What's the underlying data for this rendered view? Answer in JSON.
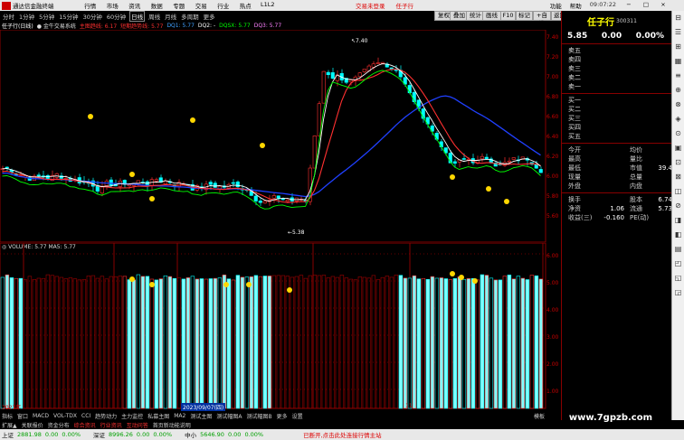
{
  "titlebar": {
    "app": "通达信金融终端",
    "menu": [
      "行情",
      "市场",
      "资讯",
      "数据",
      "专题",
      "交易",
      "行业",
      "热点",
      "L1L2"
    ],
    "promo": "交易未登录",
    "promo2": "任子行",
    "right_items": [
      "功能",
      "帮助"
    ],
    "clock": "09:07:22"
  },
  "periodbar": {
    "items": [
      "分时",
      "1分钟",
      "5分钟",
      "15分钟",
      "30分钟",
      "60分钟",
      "日线",
      "周线",
      "月线",
      "多周期",
      "更多"
    ],
    "active": "日线"
  },
  "toolbar_buttons": [
    "复权",
    "叠加",
    "统计",
    "画线",
    "F10",
    "标记",
    "+自选",
    "返回"
  ],
  "indicator_header": {
    "name": "任子行(日线)",
    "system": "● 金牛交易系统",
    "items": [
      {
        "text": "主图趋线: 6.17",
        "color": "#ff3030"
      },
      {
        "text": "短期趋势线: 5.77",
        "color": "#ff3030"
      },
      {
        "text": "DQ1: 5.77",
        "color": "#40a0ff"
      },
      {
        "text": "DQ2: -",
        "color": "#ffffff"
      },
      {
        "text": "DQSX: 5.77",
        "color": "#00ff00"
      },
      {
        "text": "DQ3: 5.77",
        "color": "#ff80ff"
      }
    ]
  },
  "volume_header": "◎ VOLUME: 5.77  MA5: 5.77",
  "chart_annotations": {
    "high": "7.40",
    "low": "5.38"
  },
  "y_axis_main": [
    "7.40",
    "7.20",
    "7.00",
    "6.80",
    "6.60",
    "6.40",
    "6.20",
    "6.00",
    "5.80",
    "5.60"
  ],
  "y_axis_vol": [
    "6.00",
    "5.00",
    "4.00",
    "3.00",
    "2.00",
    "1.00"
  ],
  "date_labels": [
    "2023年",
    "2023/09/07(四)",
    "11"
  ],
  "stock": {
    "name": "任子行",
    "code": "300311",
    "price": "5.85",
    "change": "0.00",
    "pct": "0.00%"
  },
  "orderbook": {
    "sell": [
      "卖五",
      "卖四",
      "卖三",
      "卖二",
      "卖一"
    ],
    "buy": [
      "买一",
      "买二",
      "买三",
      "买四",
      "买五"
    ]
  },
  "quote_kv": [
    [
      "今开",
      "",
      "均价",
      ""
    ],
    [
      "最高",
      "",
      "量比",
      ""
    ],
    [
      "最低",
      "",
      "市值",
      "39.4亿"
    ],
    [
      "现量",
      "",
      "总量",
      ""
    ],
    [
      "外盘",
      "",
      "内盘",
      ""
    ]
  ],
  "quote_kv2": [
    [
      "换手",
      "",
      "股本",
      "6.74亿"
    ],
    [
      "净资",
      "1.06",
      "流通",
      "5.73亿"
    ],
    [
      "收益(三)",
      "-0.160",
      "PE(动)",
      ""
    ]
  ],
  "vstrip_icons": [
    "⊟",
    "☰",
    "⊞",
    "▦",
    "≡",
    "⊕",
    "⊗",
    "◈",
    "⊙",
    "▣",
    "⊡",
    "⊠",
    "◫",
    "⊘",
    "◨",
    "◧",
    "▤",
    "◰",
    "◱",
    "◲"
  ],
  "tabs": [
    "指标",
    "窗口",
    "MACD",
    "VOL-TDX",
    "CCI",
    "趋势动力",
    "主力监控",
    "私募主图",
    "MA2",
    "测试主图",
    "测试幅图A",
    "测试幅图B",
    "更多",
    "设置"
  ],
  "tabs2": [
    "扩展▲",
    "关联报价",
    "资金分布",
    "综合资讯",
    "行业资讯",
    "互动问答",
    "首页新动能说明"
  ],
  "tabs2_highlight": [
    "综合资讯",
    "行业资讯",
    "互动问答"
  ],
  "tabs_right": "模板",
  "statusbar": {
    "sh_label": "上证",
    "sh_val": "2881.98",
    "sh_chg": "0.00",
    "sh_pct": "0.00%",
    "sz_label": "深证",
    "sz_val": "8996.26",
    "sz_chg": "0.00",
    "sz_pct": "0.00%",
    "zx_label": "中小",
    "zx_val": "5646.90",
    "zx_chg": "0.00",
    "zx_pct": "0.00%",
    "right": "已断开,点击此处连接行情主站"
  },
  "watermark": "www.7gpzb.com",
  "colors": {
    "up": "#ff3030",
    "down": "#00ffff",
    "ma_blue": "#2040ff",
    "ma_white": "#ffffff",
    "ma_green": "#00ff00",
    "ma_red": "#ff3030"
  }
}
